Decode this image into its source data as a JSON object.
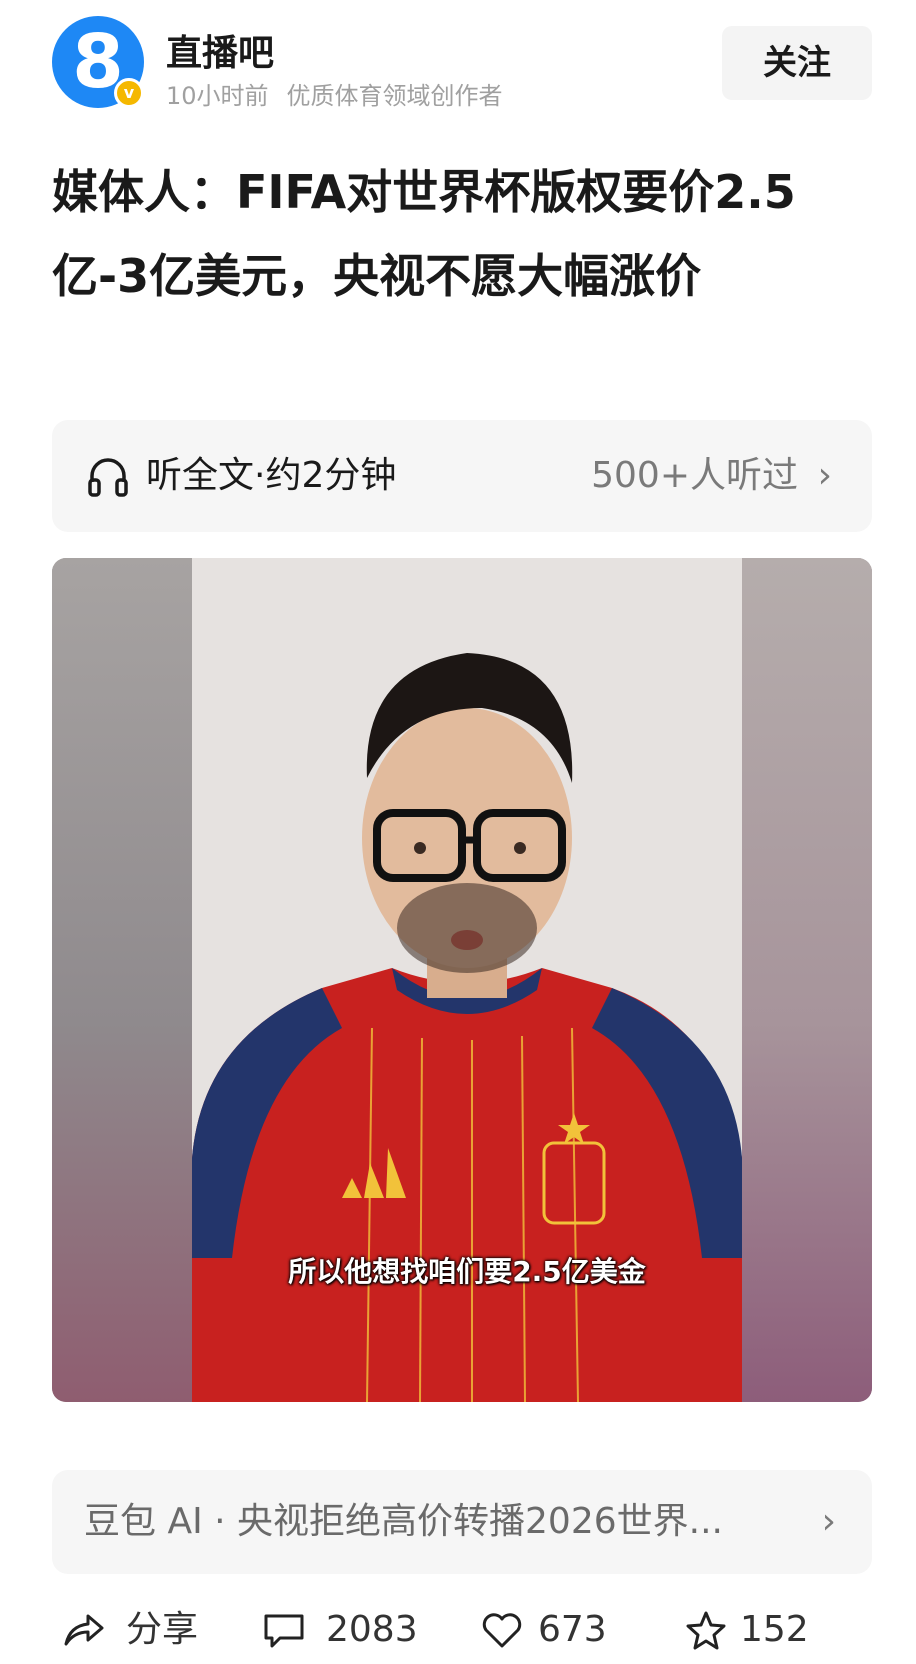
{
  "author": {
    "name": "直播吧",
    "avatar_glyph": "8",
    "verified_mark": "v",
    "time": "10小时前",
    "tag": "优质体育领域创作者",
    "follow_label": "关注",
    "brand_color": "#1e88f5"
  },
  "article": {
    "title": "媒体人：FIFA对世界杯版权要价2.5亿-3亿美元，央视不愿大幅涨价"
  },
  "listen": {
    "icon": "headphones-icon",
    "label": "听全文·约2分钟",
    "count": "500+人听过",
    "chevron": "›"
  },
  "video": {
    "subtitle": "所以他想找咱们要2.5亿美金"
  },
  "ai_summary": {
    "text": "豆包 AI · 央视拒绝高价转播2026世界...",
    "chevron": "›"
  },
  "actions": {
    "share_label": "分享",
    "comment_count": "2083",
    "like_count": "673",
    "favorite_count": "152"
  }
}
